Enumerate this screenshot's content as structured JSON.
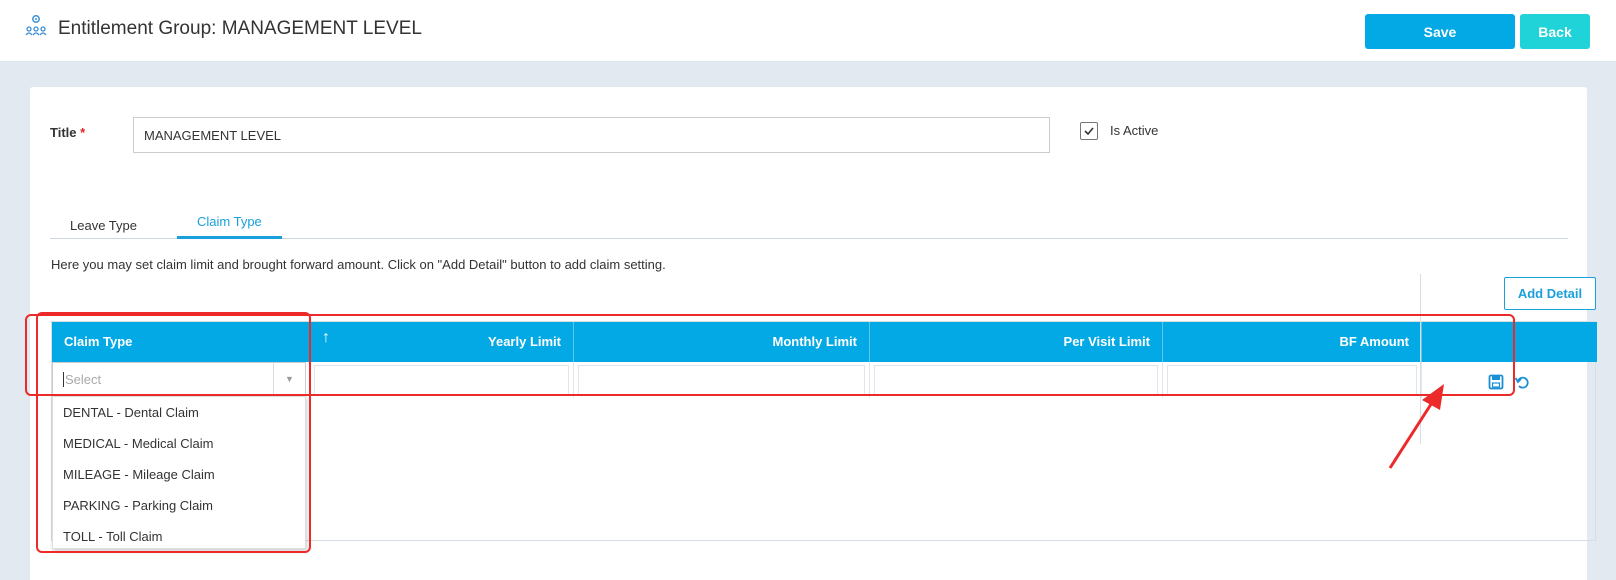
{
  "header": {
    "title": "Entitlement Group: MANAGEMENT LEVEL",
    "save_label": "Save",
    "back_label": "Back",
    "icon": "group-settings-icon"
  },
  "form": {
    "title_label": "Title",
    "required_mark": "*",
    "title_value": "MANAGEMENT LEVEL",
    "is_active_label": "Is Active",
    "is_active_checked": true
  },
  "tabs": [
    {
      "label": "Leave Type",
      "active": false
    },
    {
      "label": "Claim Type",
      "active": true
    }
  ],
  "claim": {
    "help_text": "Here you may set claim limit and brought forward amount. Click on \"Add Detail\" button to add claim setting.",
    "add_detail_label": "Add Detail",
    "columns": [
      "Claim Type",
      "Yearly Limit",
      "Monthly Limit",
      "Per Visit Limit",
      "BF Amount"
    ],
    "claim_type_placeholder": "Select",
    "options": [
      "DENTAL - Dental Claim",
      "MEDICAL - Medical Claim",
      "MILEAGE - Mileage Claim",
      "PARKING - Parking Claim",
      "TOLL - Toll Claim"
    ]
  },
  "colors": {
    "accent": "#03a9e4",
    "back": "#1fd3d8",
    "annotation": "#ec2a2a"
  }
}
